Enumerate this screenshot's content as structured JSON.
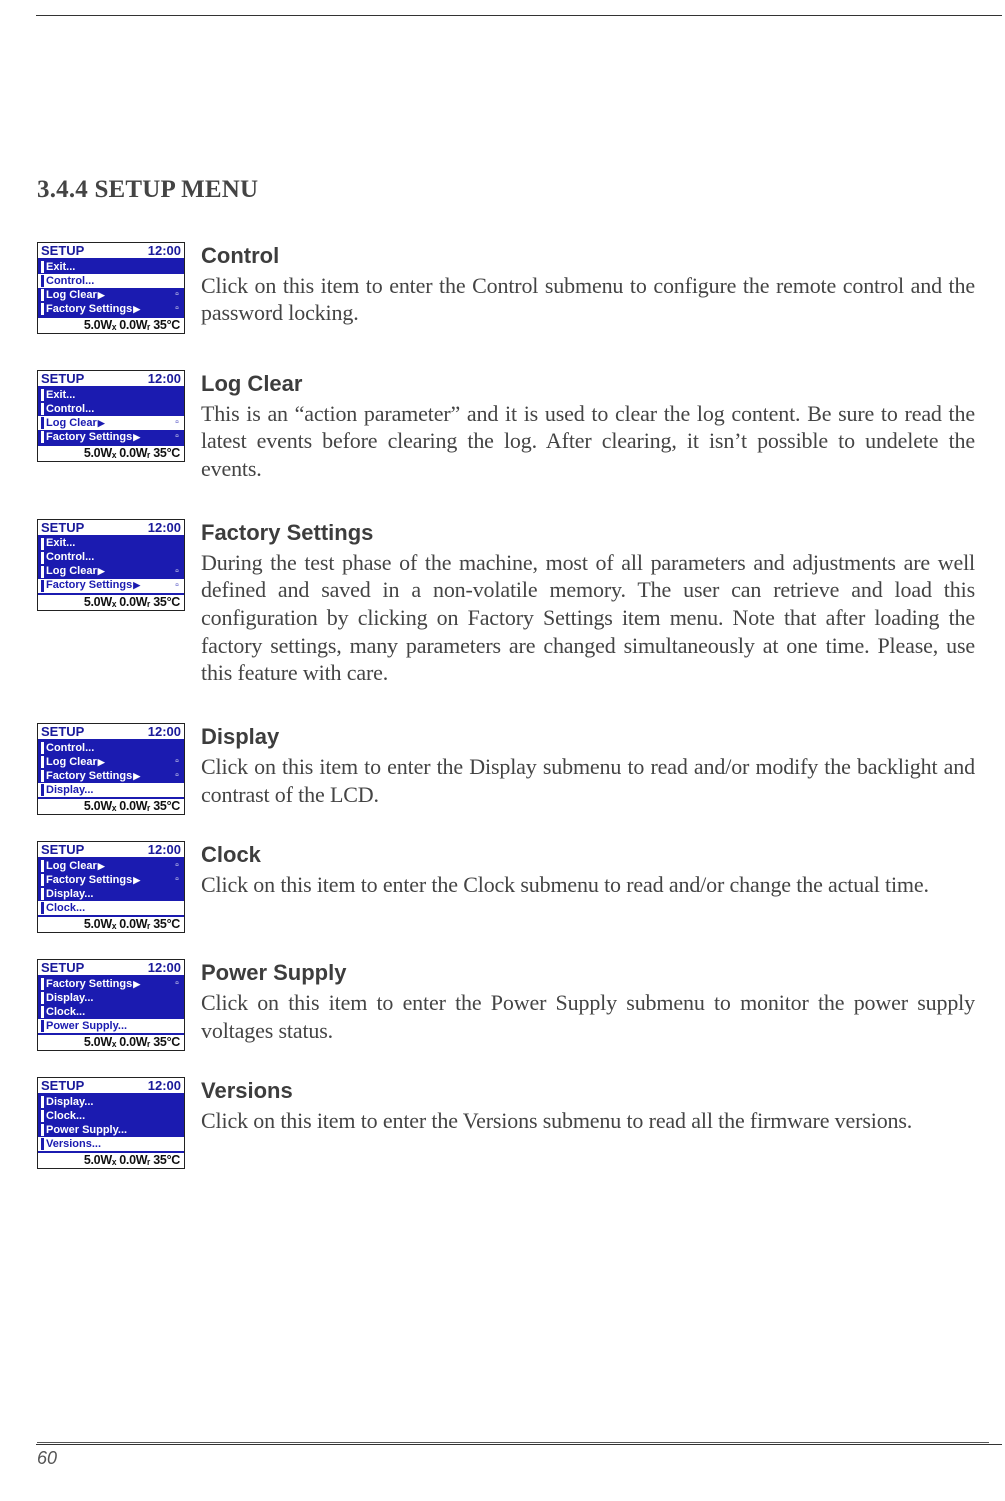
{
  "heading": "3.4.4 SETUP MENU",
  "page_number": "60",
  "lcd_common": {
    "header_left": "SETUP",
    "header_right": "12:00",
    "footer": "5.0Wₓ  0.0Wᵣ  35°C",
    "lock_glyph": "▫"
  },
  "entries": [
    {
      "title": "Control",
      "body": "Click on this item to enter the Control submenu to configure the remote control and the password locking.",
      "lcd": {
        "rows": [
          {
            "label": "Exit...",
            "arrow": false,
            "lock": false,
            "sel": false
          },
          {
            "label": "Control...",
            "arrow": false,
            "lock": false,
            "sel": true
          },
          {
            "label": "Log Clear",
            "arrow": true,
            "lock": true,
            "sel": false
          },
          {
            "label": "Factory Settings",
            "arrow": true,
            "lock": true,
            "sel": false
          }
        ]
      }
    },
    {
      "title": "Log Clear",
      "body": "This is an “action parameter” and it is used to clear the log content. Be sure to read the latest events before clearing the log. After clearing, it isn’t possible to undelete the events.",
      "lcd": {
        "rows": [
          {
            "label": "Exit...",
            "arrow": false,
            "lock": false,
            "sel": false
          },
          {
            "label": "Control...",
            "arrow": false,
            "lock": false,
            "sel": false
          },
          {
            "label": "Log Clear",
            "arrow": true,
            "lock": true,
            "sel": true
          },
          {
            "label": "Factory Settings",
            "arrow": true,
            "lock": true,
            "sel": false
          }
        ]
      }
    },
    {
      "title": "Factory Settings",
      "body": "During the test phase of the machine, most of all parameters and adjustments are well defined and saved in a non-volatile memory. The user can retrieve and load this configuration by clicking on Factory Settings item menu. Note that after loading the factory settings, many parameters are changed simultaneously at one time. Please, use this feature with care.",
      "lcd": {
        "rows": [
          {
            "label": "Exit...",
            "arrow": false,
            "lock": false,
            "sel": false
          },
          {
            "label": "Control...",
            "arrow": false,
            "lock": false,
            "sel": false
          },
          {
            "label": "Log Clear",
            "arrow": true,
            "lock": true,
            "sel": false
          },
          {
            "label": "Factory Settings",
            "arrow": true,
            "lock": true,
            "sel": true
          }
        ]
      }
    },
    {
      "title": "Display",
      "body": "Click on this item to enter the Display submenu to read and/or modify the backlight and contrast of the LCD.",
      "lcd": {
        "rows": [
          {
            "label": "Control...",
            "arrow": false,
            "lock": false,
            "sel": false
          },
          {
            "label": "Log Clear",
            "arrow": true,
            "lock": true,
            "sel": false
          },
          {
            "label": "Factory Settings",
            "arrow": true,
            "lock": true,
            "sel": false
          },
          {
            "label": "Display...",
            "arrow": false,
            "lock": false,
            "sel": true
          }
        ]
      }
    },
    {
      "title": "Clock",
      "body": "Click on this item to enter the Clock submenu to read and/or change the actual time.",
      "lcd": {
        "rows": [
          {
            "label": "Log Clear",
            "arrow": true,
            "lock": true,
            "sel": false
          },
          {
            "label": "Factory Settings",
            "arrow": true,
            "lock": true,
            "sel": false
          },
          {
            "label": "Display...",
            "arrow": false,
            "lock": false,
            "sel": false
          },
          {
            "label": "Clock...",
            "arrow": false,
            "lock": false,
            "sel": true
          }
        ]
      }
    },
    {
      "title": "Power Supply",
      "body": "Click on this item to enter the Power Supply submenu to monitor the power supply voltages status.",
      "lcd": {
        "rows": [
          {
            "label": "Factory Settings",
            "arrow": true,
            "lock": true,
            "sel": false
          },
          {
            "label": "Display...",
            "arrow": false,
            "lock": false,
            "sel": false
          },
          {
            "label": "Clock...",
            "arrow": false,
            "lock": false,
            "sel": false
          },
          {
            "label": "Power Supply...",
            "arrow": false,
            "lock": false,
            "sel": true
          }
        ]
      }
    },
    {
      "title": "Versions",
      "body": "Click on this item to enter the Versions submenu to read all the firmware versions.",
      "lcd": {
        "rows": [
          {
            "label": "Display...",
            "arrow": false,
            "lock": false,
            "sel": false
          },
          {
            "label": "Clock...",
            "arrow": false,
            "lock": false,
            "sel": false
          },
          {
            "label": "Power Supply...",
            "arrow": false,
            "lock": false,
            "sel": false
          },
          {
            "label": "Versions...",
            "arrow": false,
            "lock": false,
            "sel": true
          }
        ]
      }
    }
  ]
}
